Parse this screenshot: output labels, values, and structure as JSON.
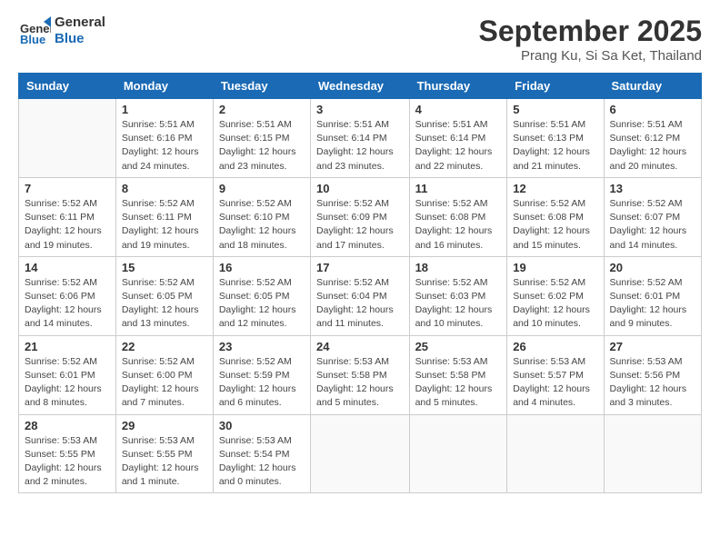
{
  "header": {
    "logo_line1": "General",
    "logo_line2": "Blue",
    "month": "September 2025",
    "location": "Prang Ku, Si Sa Ket, Thailand"
  },
  "weekdays": [
    "Sunday",
    "Monday",
    "Tuesday",
    "Wednesday",
    "Thursday",
    "Friday",
    "Saturday"
  ],
  "weeks": [
    [
      {
        "day": "",
        "info": ""
      },
      {
        "day": "1",
        "info": "Sunrise: 5:51 AM\nSunset: 6:16 PM\nDaylight: 12 hours\nand 24 minutes."
      },
      {
        "day": "2",
        "info": "Sunrise: 5:51 AM\nSunset: 6:15 PM\nDaylight: 12 hours\nand 23 minutes."
      },
      {
        "day": "3",
        "info": "Sunrise: 5:51 AM\nSunset: 6:14 PM\nDaylight: 12 hours\nand 23 minutes."
      },
      {
        "day": "4",
        "info": "Sunrise: 5:51 AM\nSunset: 6:14 PM\nDaylight: 12 hours\nand 22 minutes."
      },
      {
        "day": "5",
        "info": "Sunrise: 5:51 AM\nSunset: 6:13 PM\nDaylight: 12 hours\nand 21 minutes."
      },
      {
        "day": "6",
        "info": "Sunrise: 5:51 AM\nSunset: 6:12 PM\nDaylight: 12 hours\nand 20 minutes."
      }
    ],
    [
      {
        "day": "7",
        "info": "Sunrise: 5:52 AM\nSunset: 6:11 PM\nDaylight: 12 hours\nand 19 minutes."
      },
      {
        "day": "8",
        "info": "Sunrise: 5:52 AM\nSunset: 6:11 PM\nDaylight: 12 hours\nand 19 minutes."
      },
      {
        "day": "9",
        "info": "Sunrise: 5:52 AM\nSunset: 6:10 PM\nDaylight: 12 hours\nand 18 minutes."
      },
      {
        "day": "10",
        "info": "Sunrise: 5:52 AM\nSunset: 6:09 PM\nDaylight: 12 hours\nand 17 minutes."
      },
      {
        "day": "11",
        "info": "Sunrise: 5:52 AM\nSunset: 6:08 PM\nDaylight: 12 hours\nand 16 minutes."
      },
      {
        "day": "12",
        "info": "Sunrise: 5:52 AM\nSunset: 6:08 PM\nDaylight: 12 hours\nand 15 minutes."
      },
      {
        "day": "13",
        "info": "Sunrise: 5:52 AM\nSunset: 6:07 PM\nDaylight: 12 hours\nand 14 minutes."
      }
    ],
    [
      {
        "day": "14",
        "info": "Sunrise: 5:52 AM\nSunset: 6:06 PM\nDaylight: 12 hours\nand 14 minutes."
      },
      {
        "day": "15",
        "info": "Sunrise: 5:52 AM\nSunset: 6:05 PM\nDaylight: 12 hours\nand 13 minutes."
      },
      {
        "day": "16",
        "info": "Sunrise: 5:52 AM\nSunset: 6:05 PM\nDaylight: 12 hours\nand 12 minutes."
      },
      {
        "day": "17",
        "info": "Sunrise: 5:52 AM\nSunset: 6:04 PM\nDaylight: 12 hours\nand 11 minutes."
      },
      {
        "day": "18",
        "info": "Sunrise: 5:52 AM\nSunset: 6:03 PM\nDaylight: 12 hours\nand 10 minutes."
      },
      {
        "day": "19",
        "info": "Sunrise: 5:52 AM\nSunset: 6:02 PM\nDaylight: 12 hours\nand 10 minutes."
      },
      {
        "day": "20",
        "info": "Sunrise: 5:52 AM\nSunset: 6:01 PM\nDaylight: 12 hours\nand 9 minutes."
      }
    ],
    [
      {
        "day": "21",
        "info": "Sunrise: 5:52 AM\nSunset: 6:01 PM\nDaylight: 12 hours\nand 8 minutes."
      },
      {
        "day": "22",
        "info": "Sunrise: 5:52 AM\nSunset: 6:00 PM\nDaylight: 12 hours\nand 7 minutes."
      },
      {
        "day": "23",
        "info": "Sunrise: 5:52 AM\nSunset: 5:59 PM\nDaylight: 12 hours\nand 6 minutes."
      },
      {
        "day": "24",
        "info": "Sunrise: 5:53 AM\nSunset: 5:58 PM\nDaylight: 12 hours\nand 5 minutes."
      },
      {
        "day": "25",
        "info": "Sunrise: 5:53 AM\nSunset: 5:58 PM\nDaylight: 12 hours\nand 5 minutes."
      },
      {
        "day": "26",
        "info": "Sunrise: 5:53 AM\nSunset: 5:57 PM\nDaylight: 12 hours\nand 4 minutes."
      },
      {
        "day": "27",
        "info": "Sunrise: 5:53 AM\nSunset: 5:56 PM\nDaylight: 12 hours\nand 3 minutes."
      }
    ],
    [
      {
        "day": "28",
        "info": "Sunrise: 5:53 AM\nSunset: 5:55 PM\nDaylight: 12 hours\nand 2 minutes."
      },
      {
        "day": "29",
        "info": "Sunrise: 5:53 AM\nSunset: 5:55 PM\nDaylight: 12 hours\nand 1 minute."
      },
      {
        "day": "30",
        "info": "Sunrise: 5:53 AM\nSunset: 5:54 PM\nDaylight: 12 hours\nand 0 minutes."
      },
      {
        "day": "",
        "info": ""
      },
      {
        "day": "",
        "info": ""
      },
      {
        "day": "",
        "info": ""
      },
      {
        "day": "",
        "info": ""
      }
    ]
  ]
}
